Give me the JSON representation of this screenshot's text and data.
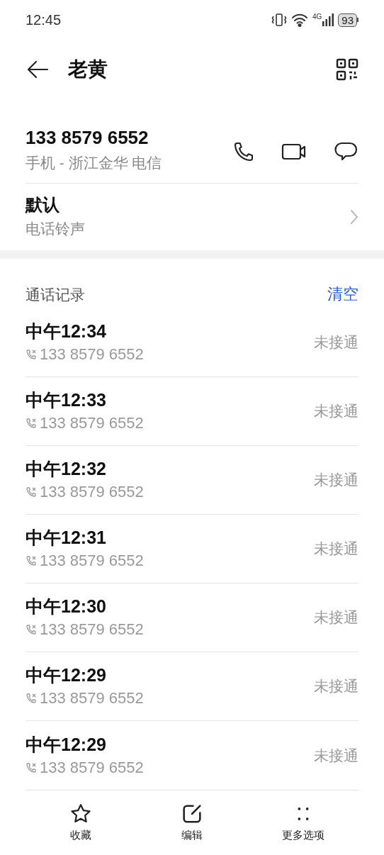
{
  "status_bar": {
    "time": "12:45",
    "network": "4G",
    "battery": "93"
  },
  "header": {
    "title": "老黄"
  },
  "contact": {
    "number": "133 8579 6552",
    "detail": "手机 - 浙江金华 电信"
  },
  "ringtone": {
    "title": "默认",
    "subtitle": "电话铃声"
  },
  "call_log": {
    "title": "通话记录",
    "clear": "清空",
    "rows": [
      {
        "time": "中午12:34",
        "number": "133 8579 6552",
        "status": "未接通"
      },
      {
        "time": "中午12:33",
        "number": "133 8579 6552",
        "status": "未接通"
      },
      {
        "time": "中午12:32",
        "number": "133 8579 6552",
        "status": "未接通"
      },
      {
        "time": "中午12:31",
        "number": "133 8579 6552",
        "status": "未接通"
      },
      {
        "time": "中午12:30",
        "number": "133 8579 6552",
        "status": "未接通"
      },
      {
        "time": "中午12:29",
        "number": "133 8579 6552",
        "status": "未接通"
      },
      {
        "time": "中午12:29",
        "number": "133 8579 6552",
        "status": "未接通"
      }
    ]
  },
  "bottom_bar": [
    {
      "kind": "star",
      "label": "收藏"
    },
    {
      "kind": "edit",
      "label": "编辑"
    },
    {
      "kind": "more",
      "label": "更多选项"
    }
  ]
}
